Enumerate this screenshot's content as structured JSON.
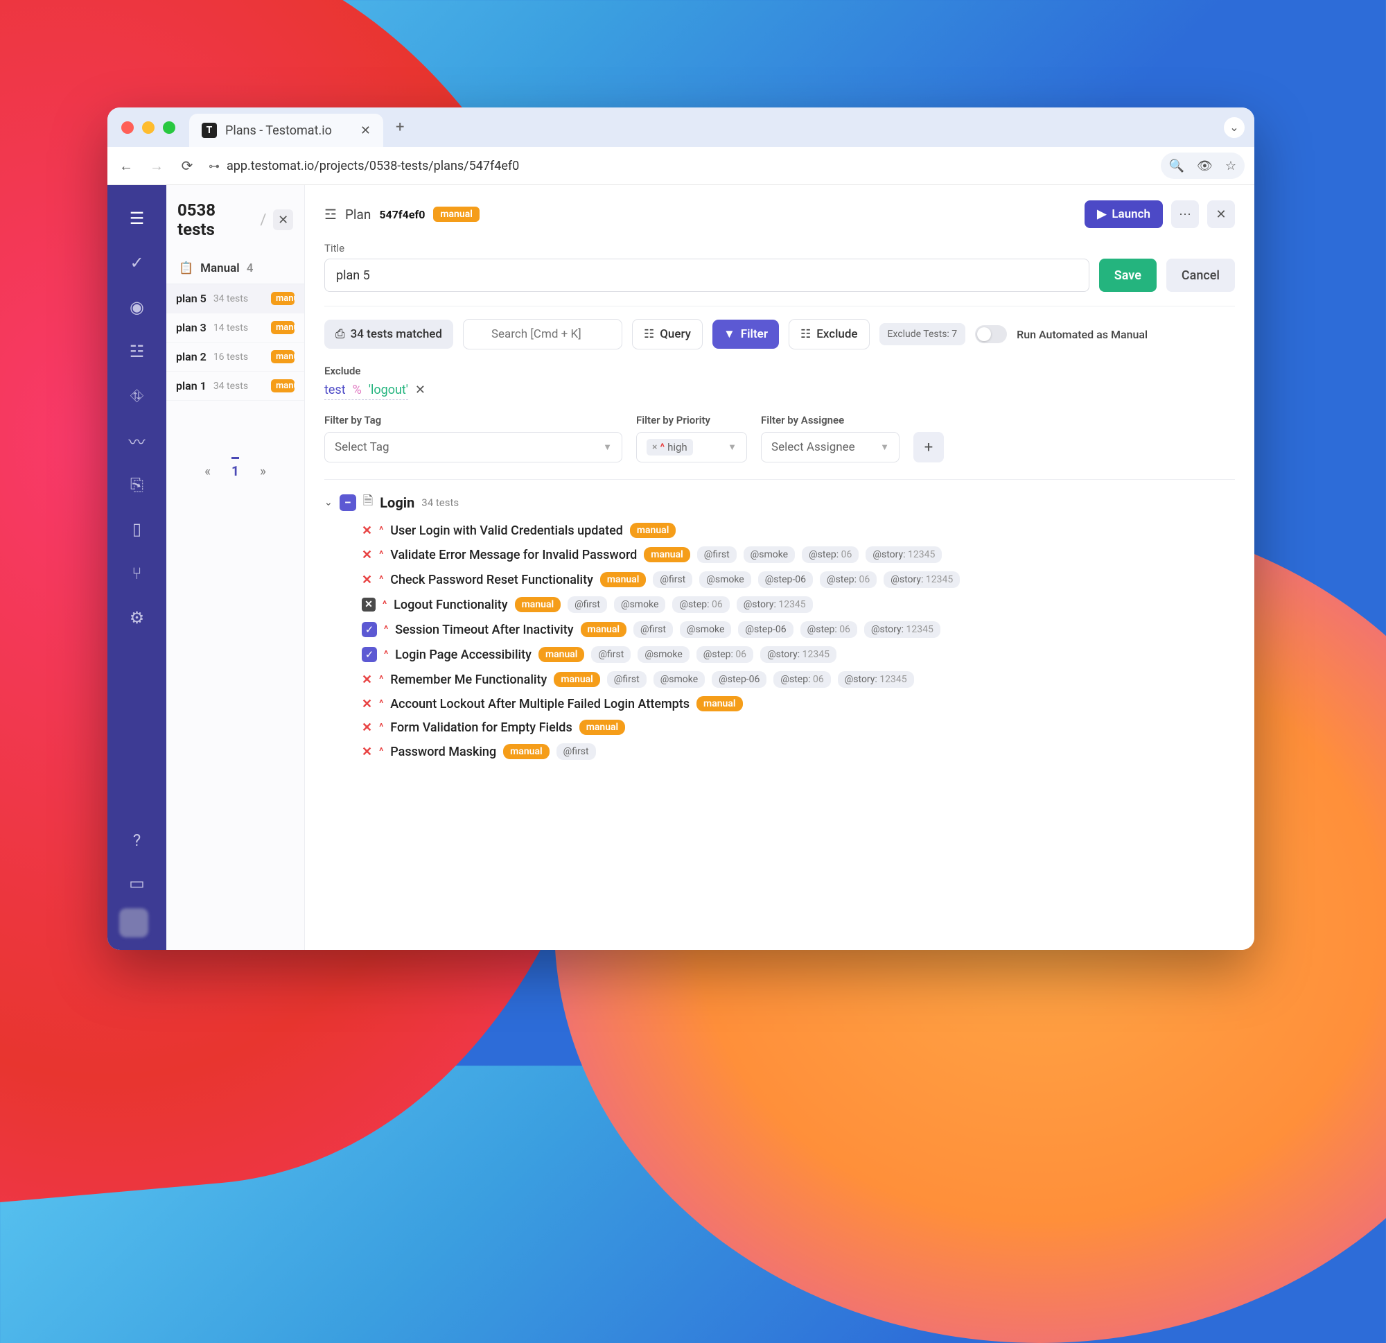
{
  "browser": {
    "tab_title": "Plans - Testomat.io",
    "url": "app.testomat.io/projects/0538-tests/plans/547f4ef0"
  },
  "sidebar": {
    "project_title": "0538 tests",
    "manual_label": "Manual",
    "manual_count": "4",
    "plans": [
      {
        "name": "plan 5",
        "count": "34 tests",
        "badge": "manual",
        "active": true
      },
      {
        "name": "plan 3",
        "count": "14 tests",
        "badge": "manual",
        "active": false
      },
      {
        "name": "plan 2",
        "count": "16 tests",
        "badge": "manual",
        "active": false
      },
      {
        "name": "plan 1",
        "count": "34 tests",
        "badge": "manual",
        "active": false
      }
    ],
    "pager": {
      "prev": "«",
      "page": "1",
      "next": "»"
    }
  },
  "header": {
    "bc_label": "Plan",
    "bc_id": "547f4ef0",
    "bc_badge": "manual",
    "launch": "Launch"
  },
  "title_section": {
    "label": "Title",
    "value": "plan 5",
    "save": "Save",
    "cancel": "Cancel"
  },
  "toolbar": {
    "matched": "34 tests matched",
    "search_placeholder": "Search [Cmd + K]",
    "query": "Query",
    "filter": "Filter",
    "exclude": "Exclude",
    "exclude_count_label": "Exclude Tests:",
    "exclude_count": "7",
    "auto_label": "Run Automated as Manual"
  },
  "exclude_query": {
    "label": "Exclude",
    "field": "test",
    "operator": "%",
    "value": "'logout'"
  },
  "filters": {
    "tag_label": "Filter by Tag",
    "tag_placeholder": "Select Tag",
    "priority_label": "Filter by Priority",
    "priority_value": "high",
    "assignee_label": "Filter by Assignee",
    "assignee_placeholder": "Select Assignee"
  },
  "suite": {
    "name": "Login",
    "count": "34 tests"
  },
  "tests": [
    {
      "status": "x",
      "prio": "up",
      "name": "User Login with Valid Credentials updated",
      "badges": [
        "manual"
      ],
      "tags": []
    },
    {
      "status": "x",
      "prio": "up",
      "name": "Validate Error Message for Invalid Password",
      "badges": [
        "manual"
      ],
      "tags": [
        {
          "k": "@first"
        },
        {
          "k": "@smoke"
        },
        {
          "k": "@step:",
          "v": "06"
        },
        {
          "k": "@story:",
          "v": "12345"
        }
      ]
    },
    {
      "status": "x",
      "prio": "up",
      "name": "Check Password Reset Functionality",
      "badges": [
        "manual"
      ],
      "tags": [
        {
          "k": "@first"
        },
        {
          "k": "@smoke"
        },
        {
          "k": "@step-06"
        },
        {
          "k": "@step:",
          "v": "06"
        },
        {
          "k": "@story:",
          "v": "12345"
        }
      ]
    },
    {
      "status": "grey",
      "prio": "up",
      "name": "Logout Functionality",
      "badges": [
        "manual"
      ],
      "tags": [
        {
          "k": "@first"
        },
        {
          "k": "@smoke"
        },
        {
          "k": "@step:",
          "v": "06"
        },
        {
          "k": "@story:",
          "v": "12345"
        }
      ]
    },
    {
      "status": "check",
      "prio": "up",
      "name": "Session Timeout After Inactivity",
      "badges": [
        "manual"
      ],
      "tags": [
        {
          "k": "@first"
        },
        {
          "k": "@smoke"
        },
        {
          "k": "@step-06"
        },
        {
          "k": "@step:",
          "v": "06"
        },
        {
          "k": "@story:",
          "v": "12345"
        }
      ]
    },
    {
      "status": "check",
      "prio": "up",
      "name": "Login Page Accessibility",
      "badges": [
        "manual"
      ],
      "tags": [
        {
          "k": "@first"
        },
        {
          "k": "@smoke"
        },
        {
          "k": "@step:",
          "v": "06"
        },
        {
          "k": "@story:",
          "v": "12345"
        }
      ]
    },
    {
      "status": "x",
      "prio": "up",
      "name": "Remember Me Functionality",
      "badges": [
        "manual"
      ],
      "tags": [
        {
          "k": "@first"
        },
        {
          "k": "@smoke"
        },
        {
          "k": "@step-06"
        },
        {
          "k": "@step:",
          "v": "06"
        },
        {
          "k": "@story:",
          "v": "12345"
        }
      ]
    },
    {
      "status": "x",
      "prio": "up",
      "name": "Account Lockout After Multiple Failed Login Attempts",
      "badges": [
        "manual"
      ],
      "tags": []
    },
    {
      "status": "x",
      "prio": "up",
      "name": "Form Validation for Empty Fields",
      "badges": [
        "manual"
      ],
      "tags": []
    },
    {
      "status": "x",
      "prio": "up",
      "name": "Password Masking",
      "badges": [
        "manual"
      ],
      "tags": [
        {
          "k": "@first"
        }
      ]
    }
  ]
}
